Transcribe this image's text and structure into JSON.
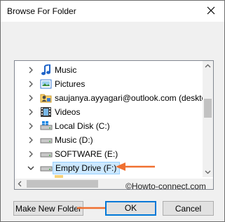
{
  "window": {
    "title": "Browse For Folder"
  },
  "tree": {
    "items": [
      {
        "label": "Music",
        "icon": "music-note-icon"
      },
      {
        "label": "Pictures",
        "icon": "pictures-folder-icon"
      },
      {
        "label": "saujanya.ayyagari@outlook.com (deskto",
        "icon": "user-folder-icon"
      },
      {
        "label": "Videos",
        "icon": "videos-folder-icon"
      },
      {
        "label": "Local Disk (C:)",
        "icon": "windows-drive-icon"
      },
      {
        "label": "Music (D:)",
        "icon": "drive-icon"
      },
      {
        "label": "SOFTWARE (E:)",
        "icon": "drive-icon"
      },
      {
        "label": "Empty Drive (F:)",
        "icon": "drive-icon",
        "expanded": true,
        "selected": true
      }
    ]
  },
  "watermark": "©Howto-connect.com",
  "buttons": {
    "new_folder": "Make New Folder",
    "ok": "OK",
    "cancel": "Cancel"
  },
  "colors": {
    "accent": "#0078d7",
    "selection": "#cce8ff",
    "annotation_arrow": "#f07030"
  }
}
